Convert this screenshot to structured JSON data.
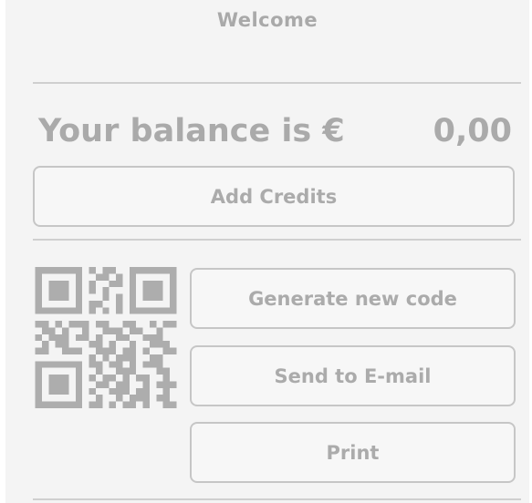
{
  "header": {
    "title": "Welcome"
  },
  "balance": {
    "label": "Your balance is €",
    "amount": "0,00"
  },
  "actions": {
    "add_credits": "Add Credits",
    "generate_code": "Generate new code",
    "send_email": "Send to E-mail",
    "print": "Print"
  },
  "qr": {
    "icon": "qr-code",
    "color": "#adadad"
  },
  "colors": {
    "background": "#f4f4f4",
    "text": "#a9a9a9",
    "border": "#c6c6c6"
  }
}
